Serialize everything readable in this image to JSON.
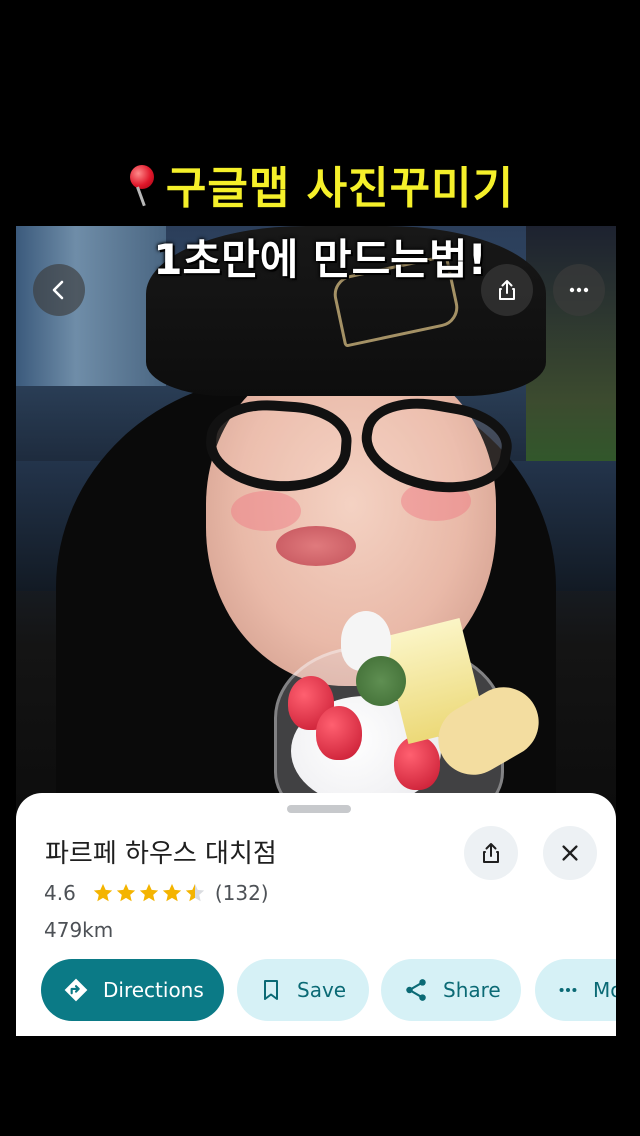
{
  "overlay": {
    "title_line1": "구글맵 사진꾸미기",
    "title_line2": "1초만에 만드는법!",
    "pin_icon": "round-pushpin-icon"
  },
  "top_controls": {
    "back_icon": "chevron-left-icon",
    "share_icon": "share-icon",
    "more_icon": "more-horizontal-icon"
  },
  "place": {
    "name": "파르페 하우스 대치점",
    "rating": "4.6",
    "stars": 4.5,
    "review_count": "(132)",
    "distance": "479km"
  },
  "actions": {
    "directions_label": "Directions",
    "save_label": "Save",
    "share_label": "Share",
    "more_label": "More"
  },
  "colors": {
    "title_yellow": "#f5f02a",
    "primary_teal": "#0b7a86",
    "chip_bg": "#d6f1f6",
    "star_gold": "#f4b400"
  }
}
